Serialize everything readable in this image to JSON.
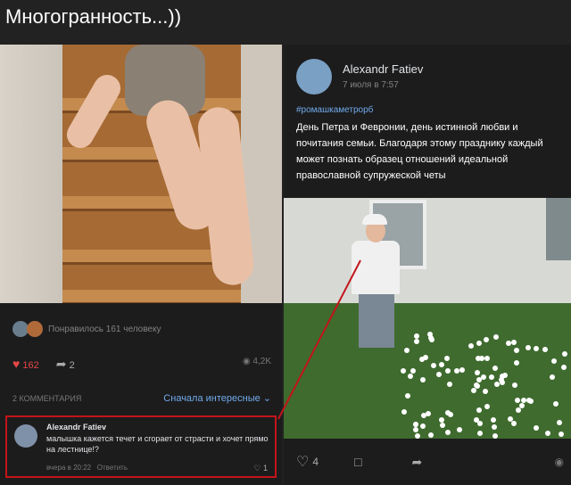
{
  "title": "Многогранность...))",
  "left_post": {
    "likes_text": "Понравилось 161 человеку",
    "like_count": "162",
    "share_count": "2",
    "views": "4,2K",
    "comments_header": "2 КОММЕНТАРИЯ",
    "sort_label": "Сначала интересные",
    "comment": {
      "author": "Alexandr Fatiev",
      "text": "малышка кажется течет и сгорает от страсти и хочет прямо на лестнице!?",
      "time": "вчера в 20:22",
      "reply": "Ответить",
      "likes": "1"
    }
  },
  "right_post": {
    "author": "Alexandr Fatiev",
    "date": "7 июля в 7:57",
    "hashtag": "#ромашкаметрорб",
    "text": "День Петра и Февронии, день истинной любви и почитания семьи. Благодаря этому празднику каждый может познать образец отношений идеальной православной супружеской четы",
    "like_count": "4"
  },
  "colors": {
    "highlight": "#c3141a",
    "link": "#71aaeb",
    "like": "#e64646"
  }
}
